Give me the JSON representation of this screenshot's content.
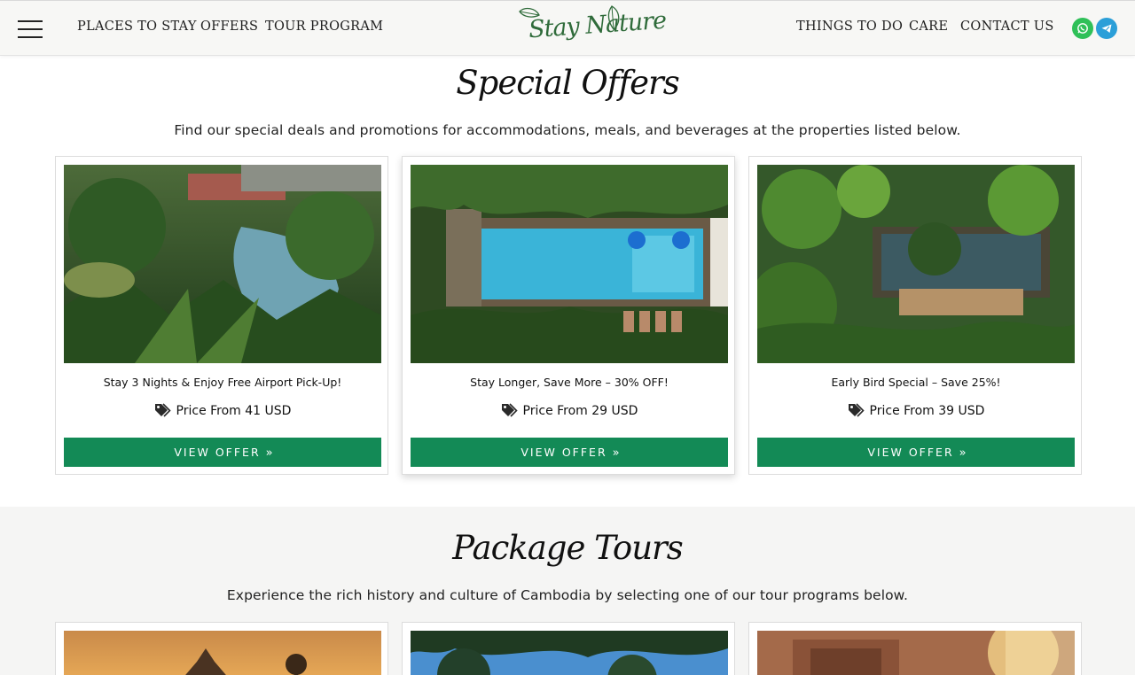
{
  "header": {
    "nav_left": [
      "PLACES TO STAY",
      "OFFERS",
      "TOUR PROGRAM"
    ],
    "nav_right": [
      "THINGS TO DO",
      "CARE",
      "CONTACT US"
    ],
    "logo_text": "Stay Nature",
    "social": [
      "whatsapp-icon",
      "telegram-icon"
    ]
  },
  "offers": {
    "title": "Special Offers",
    "subtitle": "Find our special deals and promotions for accommodations, meals, and beverages at the properties listed below.",
    "cards": [
      {
        "title": "Stay 3 Nights & Enjoy Free Airport Pick-Up!",
        "price": "Price From 41 USD",
        "button": "VIEW OFFER"
      },
      {
        "title": "Stay Longer, Save More – 30% OFF!",
        "price": "Price From 29 USD",
        "button": "VIEW OFFER"
      },
      {
        "title": "Early Bird Special – Save 25%!",
        "price": "Price From 39 USD",
        "button": "VIEW OFFER"
      }
    ]
  },
  "tours": {
    "title": "Package Tours",
    "subtitle": "Experience the rich history and culture of Cambodia by selecting one of our tour programs below."
  },
  "colors": {
    "accent_green": "#138a56",
    "logo_green": "#2f6b3a",
    "whatsapp": "#2fc058",
    "telegram": "#2b9fd8",
    "tours_band": "#f5f5f4"
  }
}
